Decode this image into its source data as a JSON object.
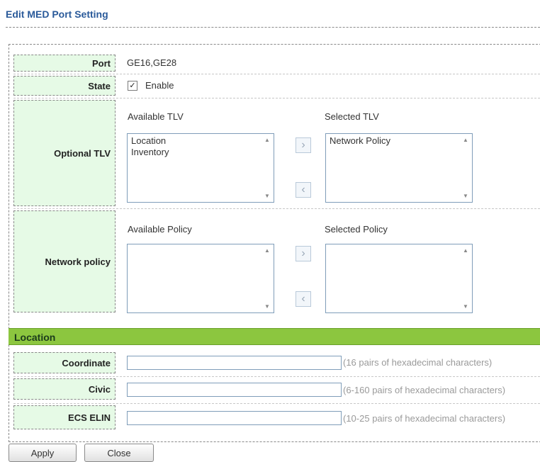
{
  "title": "Edit MED Port Setting",
  "rows": {
    "port": {
      "label": "Port",
      "value": "GE16,GE28"
    },
    "state": {
      "label": "State",
      "checkbox_label": "Enable",
      "checked": true
    },
    "optional_tlv": {
      "label": "Optional TLV",
      "available_header": "Available TLV",
      "selected_header": "Selected TLV",
      "available_items": [
        "Location",
        "Inventory"
      ],
      "selected_items": [
        "Network Policy"
      ],
      "add_icon": "chevron-right-icon",
      "remove_icon": "chevron-left-icon"
    },
    "network_policy": {
      "label": "Network policy",
      "available_header": "Available Policy",
      "selected_header": "Selected Policy",
      "available_items": [],
      "selected_items": []
    }
  },
  "location": {
    "header": "Location",
    "coordinate": {
      "label": "Coordinate",
      "value": "",
      "hint": "(16 pairs of hexadecimal characters)"
    },
    "civic": {
      "label": "Civic",
      "value": "",
      "hint": "(6-160 pairs of hexadecimal characters)"
    },
    "ecs_elin": {
      "label": "ECS ELIN",
      "value": "",
      "hint": "(10-25 pairs of hexadecimal characters)"
    }
  },
  "buttons": {
    "apply": "Apply",
    "close": "Close"
  },
  "colors": {
    "title": "#2a5a9a",
    "label_bg": "#e6fae6",
    "section_bar": "#8cc63f"
  }
}
